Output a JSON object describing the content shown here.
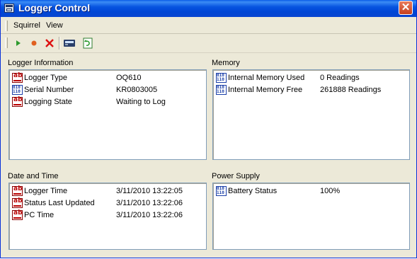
{
  "window": {
    "title": "Logger Control"
  },
  "menu": [
    {
      "label": "Squirrel"
    },
    {
      "label": "View"
    }
  ],
  "sections": {
    "logger_info": {
      "label": "Logger Information",
      "rows": [
        {
          "name": "Logger Type",
          "value": "OQ610",
          "icon": "text-field-icon"
        },
        {
          "name": "Serial Number",
          "value": "KR0803005",
          "icon": "numeric-field-icon"
        },
        {
          "name": "Logging State",
          "value": "Waiting to Log",
          "icon": "text-field-icon"
        }
      ]
    },
    "memory": {
      "label": "Memory",
      "rows": [
        {
          "name": "Internal Memory Used",
          "value": "0 Readings",
          "icon": "numeric-field-icon"
        },
        {
          "name": "Internal Memory Free",
          "value": "261888 Readings",
          "icon": "numeric-field-icon"
        }
      ]
    },
    "date_time": {
      "label": "Date and Time",
      "rows": [
        {
          "name": "Logger Time",
          "value": "3/11/2010 13:22:05",
          "icon": "text-field-icon"
        },
        {
          "name": "Status Last Updated",
          "value": "3/11/2010 13:22:06",
          "icon": "text-field-icon"
        },
        {
          "name": "PC Time",
          "value": "3/11/2010 13:22:06",
          "icon": "text-field-icon"
        }
      ]
    },
    "power": {
      "label": "Power Supply",
      "rows": [
        {
          "name": "Battery Status",
          "value": "100%",
          "icon": "numeric-field-icon"
        }
      ]
    }
  },
  "colors": {
    "title_bar": "#0054e3",
    "panel_border": "#7f9db9",
    "window_bg": "#ece9d8"
  }
}
